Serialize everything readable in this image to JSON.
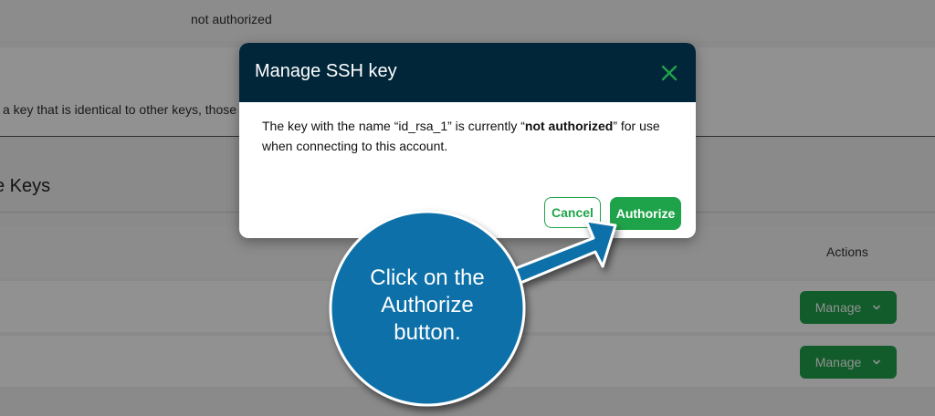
{
  "background": {
    "status_value": "not authorized",
    "key_notice": "a key that is identical to other keys, those",
    "section_title": "e Keys",
    "actions_header": "Actions",
    "rows": [
      {
        "action_label": "Manage"
      },
      {
        "action_label": "Manage"
      }
    ]
  },
  "modal": {
    "title": "Manage SSH key",
    "body_prefix": "The key with the name “id_rsa_1” is currently “",
    "body_status": "not authorized",
    "body_suffix": "” for use when connecting to this account.",
    "cancel_label": "Cancel",
    "authorize_label": "Authorize"
  },
  "callout": {
    "line1": "Click on the",
    "line2": "Authorize",
    "line3": "button."
  },
  "colors": {
    "modal_header": "#01263a",
    "accent_green": "#1fa34a",
    "callout_blue": "#0a6fa8"
  },
  "icons": {
    "close": "close-icon",
    "chevron": "chevron-down-icon",
    "arrow": "arrow-icon"
  }
}
